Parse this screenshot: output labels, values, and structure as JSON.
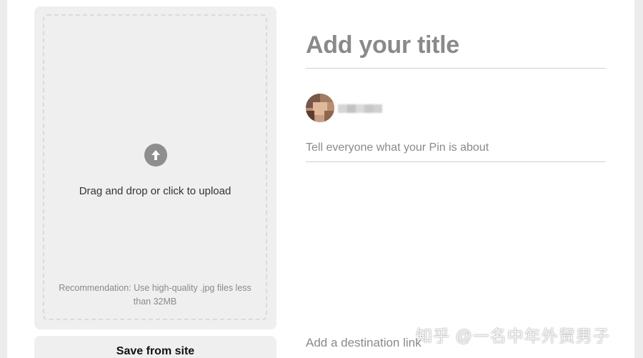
{
  "upload": {
    "prompt": "Drag and drop or click to upload",
    "recommendation": "Recommendation: Use high-quality .jpg files less than 32MB",
    "icon": "arrow-up-circle-icon"
  },
  "actions": {
    "save_from_site": "Save from site"
  },
  "pin_form": {
    "title_placeholder": "Add your title",
    "description_placeholder": "Tell everyone what your Pin is about",
    "destination_placeholder": "Add a destination link"
  },
  "watermark": {
    "text": "知乎 @一名中年外贸男子"
  },
  "colors": {
    "panel_bg": "#efefef",
    "placeholder": "#8a8a8a",
    "upload_icon": "#8e8e8e"
  }
}
